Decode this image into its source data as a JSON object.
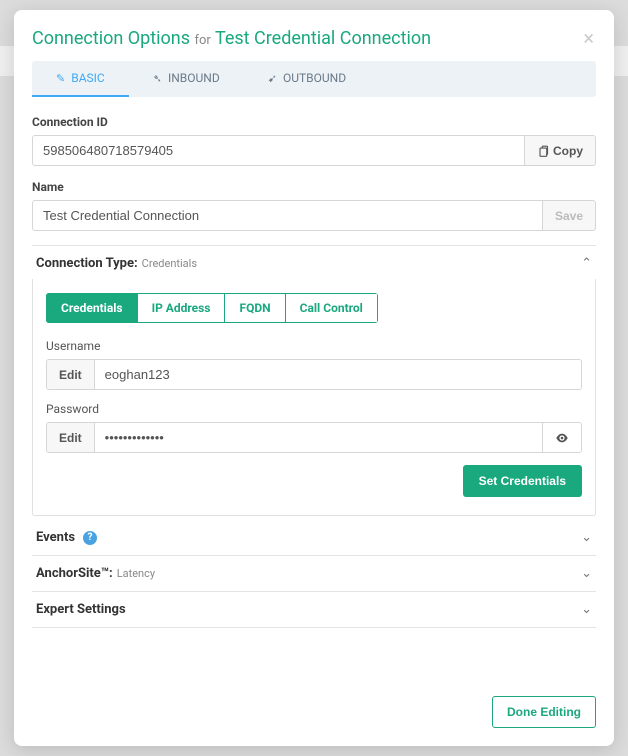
{
  "modal": {
    "title_prefix": "Connection Options",
    "title_for": "for",
    "title_name": "Test Credential Connection"
  },
  "tabs": {
    "basic": "BASIC",
    "inbound": "INBOUND",
    "outbound": "OUTBOUND"
  },
  "fields": {
    "connection_id_label": "Connection ID",
    "connection_id_value": "598506480718579405",
    "copy_label": "Copy",
    "name_label": "Name",
    "name_value": "Test Credential Connection",
    "save_label": "Save"
  },
  "connection_type": {
    "label": "Connection Type:",
    "value": "Credentials",
    "tabs": {
      "credentials": "Credentials",
      "ip": "IP Address",
      "fqdn": "FQDN",
      "call_control": "Call Control"
    },
    "username_label": "Username",
    "username_value": "eoghan123",
    "password_label": "Password",
    "password_value": "•••••••••••••",
    "edit_label": "Edit",
    "set_credentials": "Set Credentials"
  },
  "sections": {
    "events": "Events",
    "anchorsite": "AnchorSite™:",
    "anchorsite_value": "Latency",
    "expert": "Expert Settings"
  },
  "footer": {
    "done": "Done Editing"
  }
}
